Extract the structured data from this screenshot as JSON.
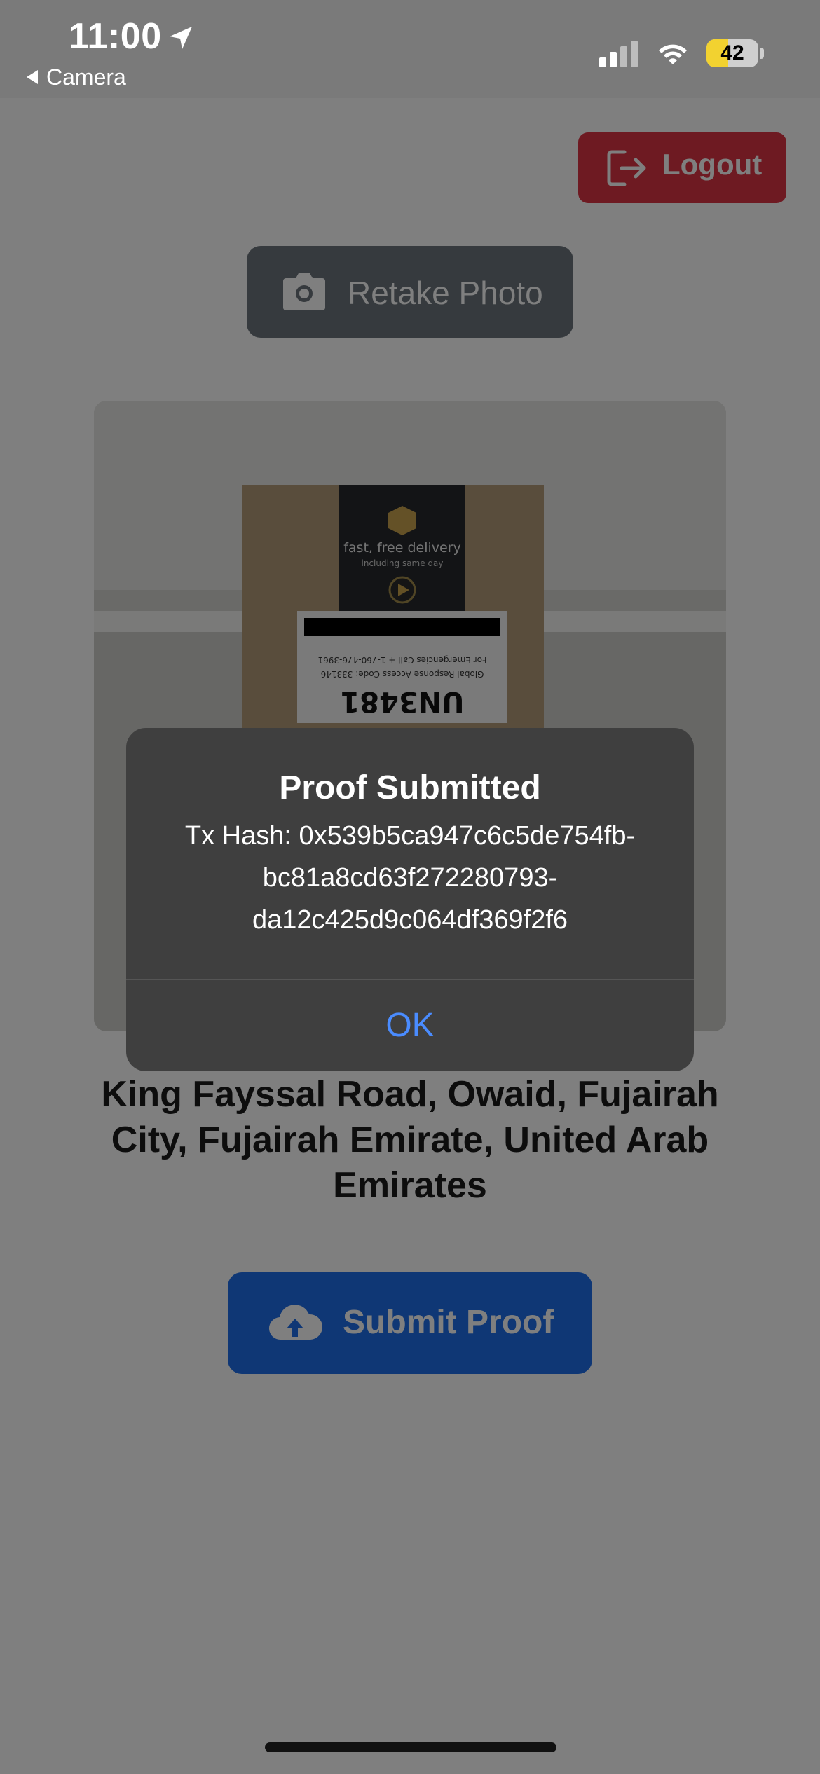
{
  "status_bar": {
    "time": "11:00",
    "back_app": "Camera",
    "battery_level": "42",
    "battery_fraction": 0.42
  },
  "header": {
    "logout_label": "Logout"
  },
  "camera": {
    "retake_label": "Retake Photo"
  },
  "photo": {
    "box_text_1": "fast, free delivery",
    "box_text_2": "including same day",
    "label_line_1": "For Emergencies Call + 1-760-476-3961",
    "label_line_2": "Global Response Access Code: 333146",
    "label_id": "UN3481"
  },
  "location": {
    "address": "King Fayssal Road, Owaid, Fujairah City, Fujairah Emirate, United Arab Emirates"
  },
  "actions": {
    "submit_label": "Submit Proof"
  },
  "alert": {
    "title": "Proof Submitted",
    "message_line_1": "Tx Hash: 0x539b5ca947c6c5de754fb-",
    "message_line_2": "bc81a8cd63f272280793-",
    "message_line_3": "da12c425d9c064df369f2f6",
    "ok_label": "OK"
  },
  "colors": {
    "logout": "#dc3545",
    "retake": "#6c757d",
    "submit": "#1f6feb",
    "alert_bg": "#3f3f3f",
    "alert_action": "#4a8cff"
  },
  "icons": [
    "location-arrow-icon",
    "cellular-signal-icon",
    "wifi-icon",
    "battery-icon",
    "logout-icon",
    "camera-icon",
    "cloud-upload-icon"
  ]
}
